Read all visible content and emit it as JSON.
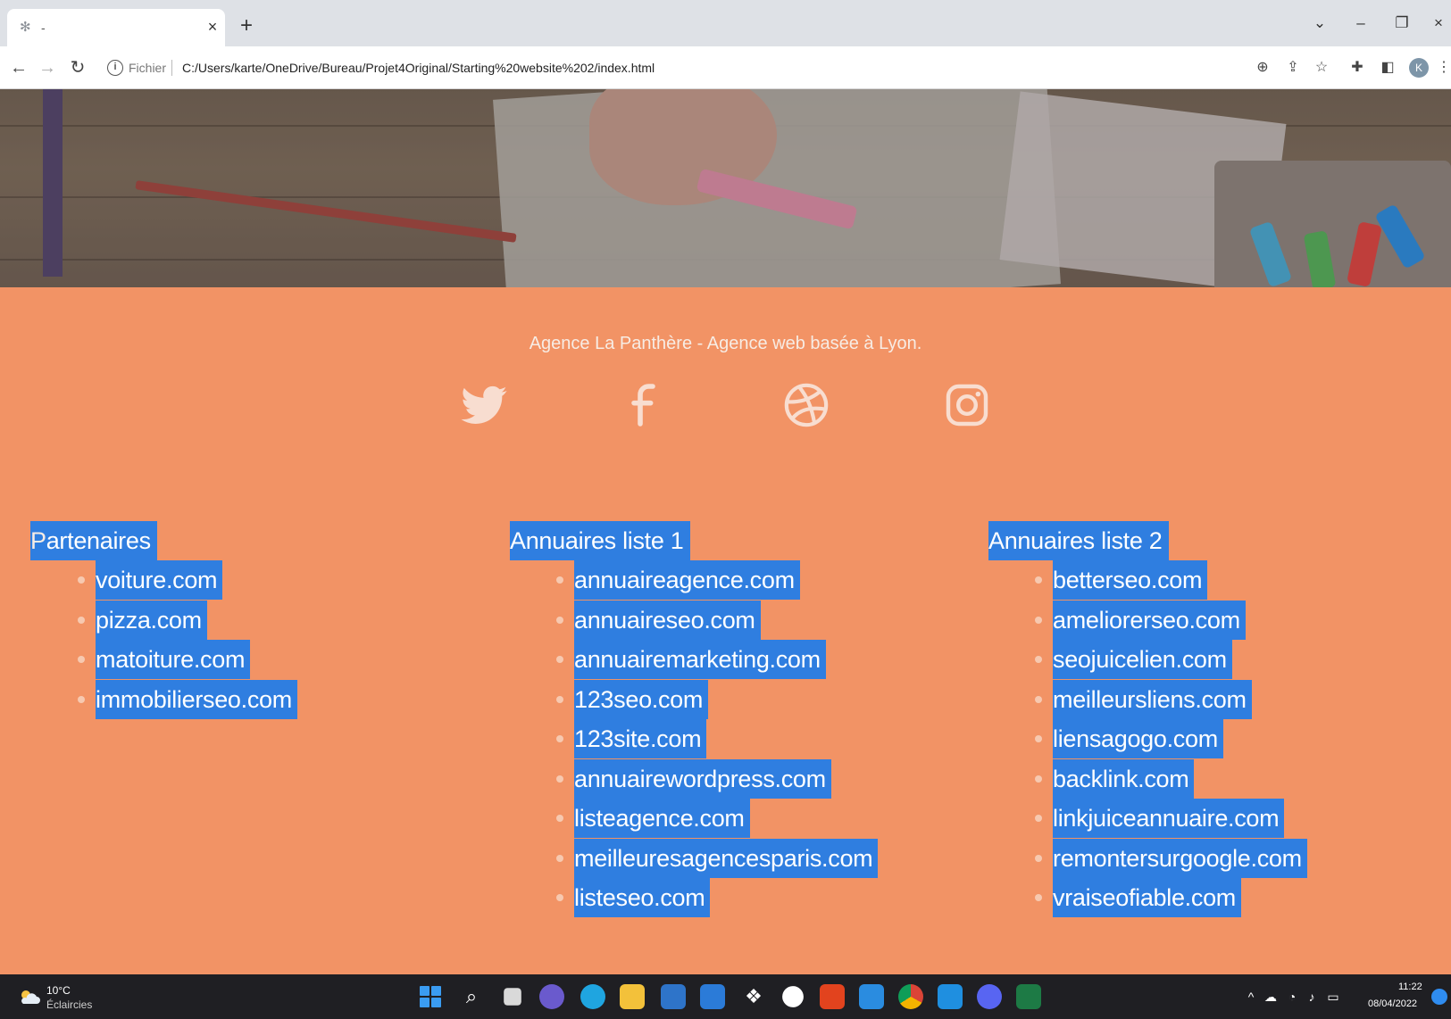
{
  "browser": {
    "tab_title": "-",
    "url_scheme_label": "Fichier",
    "url": "C:/Users/karte/OneDrive/Bureau/Projet4Original/Starting%20website%202/index.html"
  },
  "footer": {
    "tagline": "Agence La Panthère - Agence web basée à Lyon.",
    "social_icons": [
      "twitter-icon",
      "facebook-icon",
      "dribbble-icon",
      "instagram-icon"
    ],
    "columns": [
      {
        "title_first_letter": "P",
        "title_rest": "artenaires",
        "items": [
          "voiture.com",
          "pizza.com",
          "matoiture.com",
          "immobilierseo.com"
        ]
      },
      {
        "title_first_letter": "",
        "title_rest": "Annuaires liste 1",
        "items": [
          "annuaireagence.com",
          "annuaireseo.com",
          "annuairemarketing.com",
          "123seo.com",
          "123site.com",
          "annuairewordpress.com",
          "listeagence.com",
          "meilleuresagencesparis.com",
          "listeseo.com"
        ]
      },
      {
        "title_first_letter": "",
        "title_rest": "Annuaires liste 2",
        "items": [
          "betterseo.com",
          "ameliorerseo.com",
          "seojuicelien.com",
          "meilleursliens.com",
          "liensagogo.com",
          "backlink.com",
          "linkjuiceannuaire.com",
          "remontersurgoogle.com",
          "vraiseofiable.com"
        ]
      }
    ]
  },
  "taskbar": {
    "weather_temp": "10°C",
    "weather_desc": "Éclaircies",
    "time": "11:22",
    "date": "08/04/2022"
  },
  "colors": {
    "footer_bg": "#f29365",
    "selection": "#2f7ee0",
    "text_light": "#f7ece4"
  }
}
